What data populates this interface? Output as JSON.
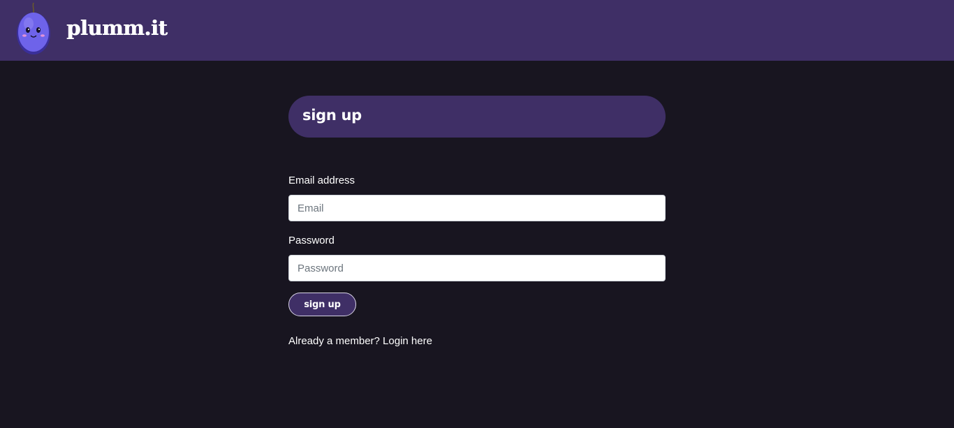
{
  "navbar": {
    "brand": "plumm.it",
    "logo_icon": "plum-mascot-icon",
    "background": "#3f2f66"
  },
  "form": {
    "heading": "sign up",
    "email_label": "Email address",
    "email_placeholder": "Email",
    "email_value": "",
    "password_label": "Password",
    "password_placeholder": "Password",
    "password_value": "",
    "submit_label": "sign up",
    "login_prompt": "Already a member? Login here"
  },
  "colors": {
    "page_background": "#181520",
    "accent": "#3f2f66",
    "plum": "#6a5ce8"
  }
}
